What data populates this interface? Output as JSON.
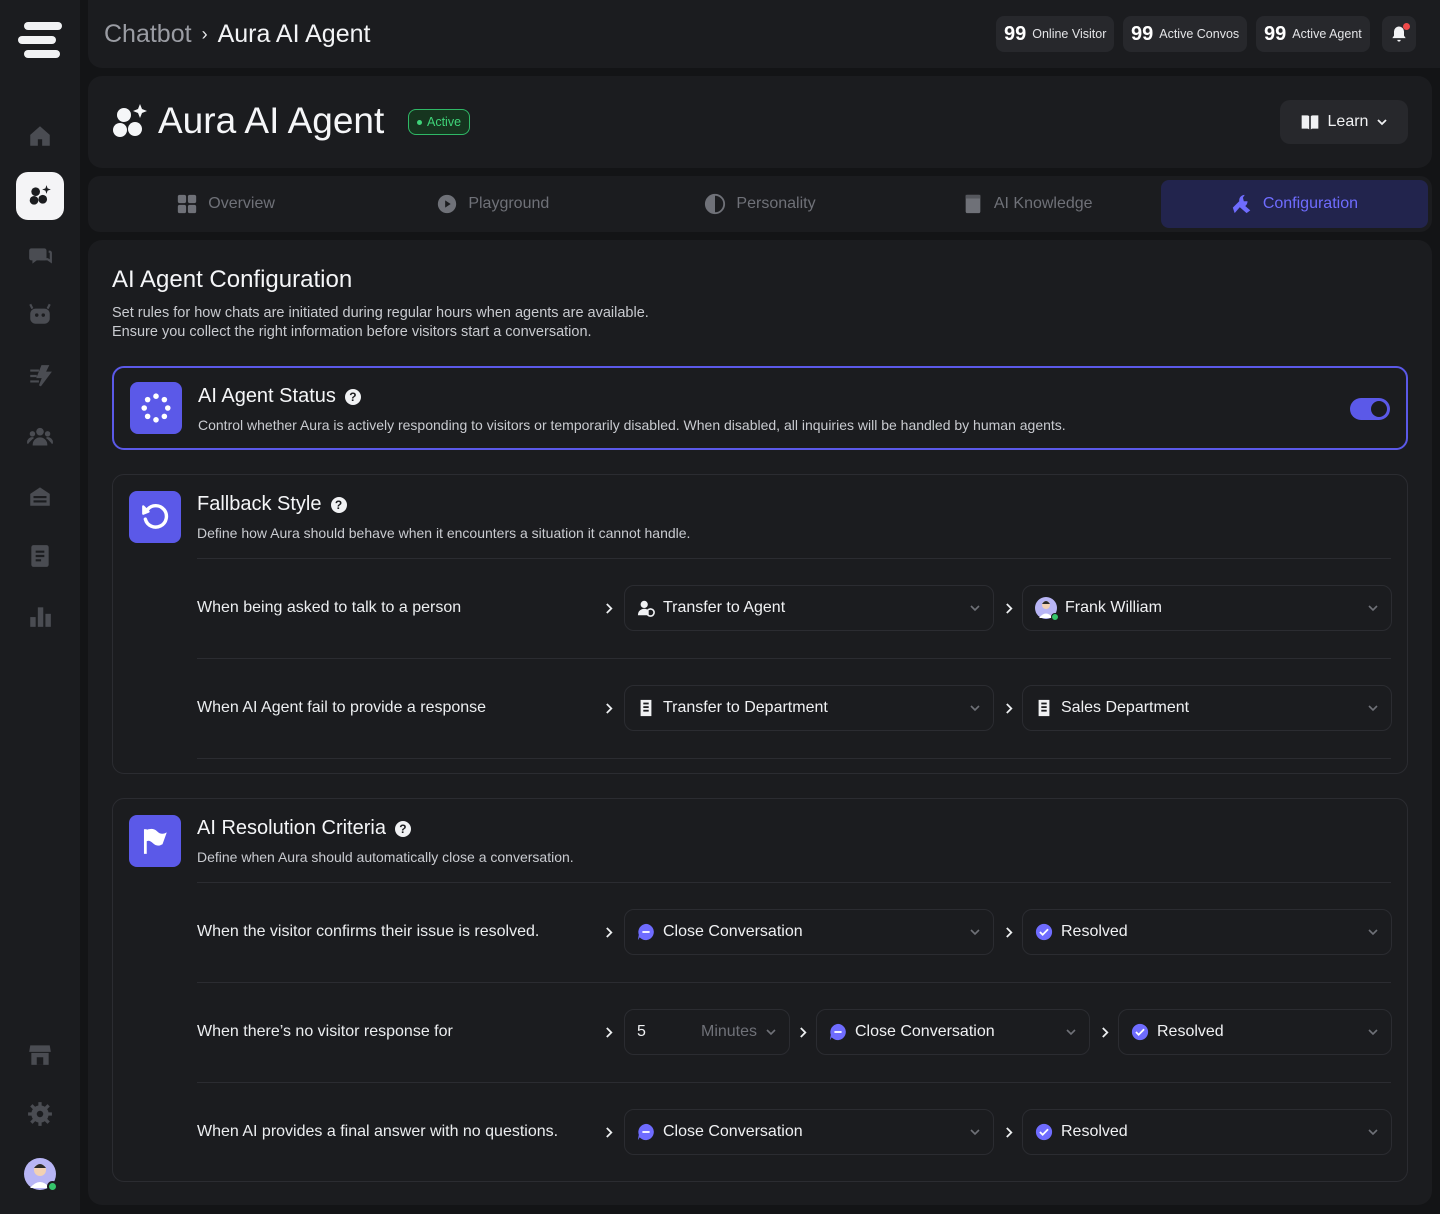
{
  "breadcrumb": {
    "root": "Chatbot",
    "current": "Aura AI Agent"
  },
  "stats": [
    {
      "value": "99",
      "label": "Online Visitor"
    },
    {
      "value": "99",
      "label": "Active Convos"
    },
    {
      "value": "99",
      "label": "Active Agent"
    }
  ],
  "header": {
    "title": "Aura AI Agent",
    "status": "Active",
    "learn_label": "Learn"
  },
  "tabs": [
    {
      "label": "Overview",
      "icon": "grid-icon"
    },
    {
      "label": "Playground",
      "icon": "play-icon"
    },
    {
      "label": "Personality",
      "icon": "half-circle-icon"
    },
    {
      "label": "AI Knowledge",
      "icon": "book-icon"
    },
    {
      "label": "Configuration",
      "icon": "wrench-icon",
      "active": true
    }
  ],
  "main": {
    "title": "AI Agent Configuration",
    "description": "Set rules for how chats are initiated during regular hours when agents are available.\nEnsure you collect the right information before visitors start a conversation."
  },
  "status_card": {
    "title": "AI Agent Status",
    "description": "Control whether Aura is actively responding to visitors or temporarily disabled. When disabled, all inquiries will be handled by human agents.",
    "enabled": true
  },
  "fallback": {
    "title": "Fallback Style",
    "description": "Define how Aura should behave when it encounters a situation it cannot handle.",
    "rules": [
      {
        "label": "When being asked to talk to a person",
        "action": "Transfer to Agent",
        "target": "Frank William"
      },
      {
        "label": "When AI Agent fail to provide a response",
        "action": "Transfer to Department",
        "target": "Sales Department"
      }
    ]
  },
  "resolution": {
    "title": "AI Resolution Criteria",
    "description": "Define when Aura should automatically close a conversation.",
    "rules": [
      {
        "label": "When the visitor confirms their issue is resolved.",
        "action": "Close Conversation",
        "target": "Resolved"
      },
      {
        "label": "When there’s no visitor response for",
        "duration": "5",
        "unit": "Minutes",
        "action": "Close Conversation",
        "target": "Resolved"
      },
      {
        "label": "When AI provides a final answer with no questions.",
        "action": "Close Conversation",
        "target": "Resolved"
      }
    ]
  },
  "colors": {
    "accent": "#5b59e8",
    "active_status": "#3fd479",
    "background": "#131416",
    "card": "#1b1c1f"
  }
}
